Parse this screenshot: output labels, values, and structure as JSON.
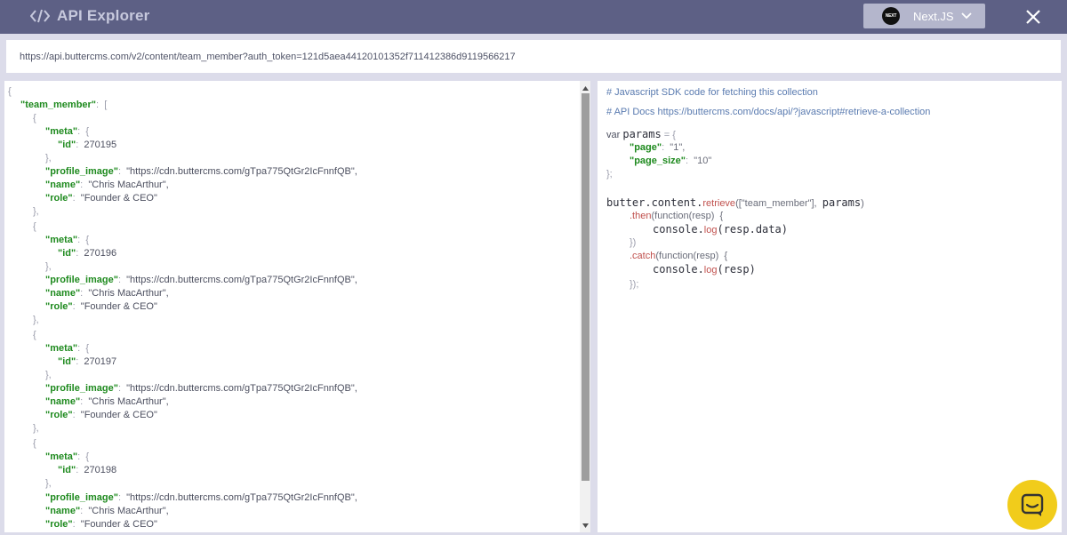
{
  "header": {
    "title": "API Explorer",
    "framework_logo_text": "NEXT",
    "framework_label": "Next.JS"
  },
  "url_bar": {
    "url": "https://api.buttercms.com/v2/content/team_member?auth_token=121d5aea44120101352f711412386d9119566217"
  },
  "json": {
    "open_brace": "{",
    "root_key": "\"team_member\"",
    "colon": ":",
    "open_bracket": "[",
    "items": [
      {
        "open": "{",
        "meta_key": "\"meta\"",
        "meta_open": "{",
        "id_key": "\"id\"",
        "id_value": "270195",
        "meta_close": "},",
        "image_key": "\"profile_image\"",
        "image_value": "\"https://cdn.buttercms.com/gTpa775QtGr2IcFnnfQB\",",
        "name_key": "\"name\"",
        "name_value": "\"Chris MacArthur\",",
        "role_key": "\"role\"",
        "role_value": "\"Founder & CEO\"",
        "close": "},"
      },
      {
        "open": "{",
        "meta_key": "\"meta\"",
        "meta_open": "{",
        "id_key": "\"id\"",
        "id_value": "270196",
        "meta_close": "},",
        "image_key": "\"profile_image\"",
        "image_value": "\"https://cdn.buttercms.com/gTpa775QtGr2IcFnnfQB\",",
        "name_key": "\"name\"",
        "name_value": "\"Chris MacArthur\",",
        "role_key": "\"role\"",
        "role_value": "\"Founder & CEO\"",
        "close": "},"
      },
      {
        "open": "{",
        "meta_key": "\"meta\"",
        "meta_open": "{",
        "id_key": "\"id\"",
        "id_value": "270197",
        "meta_close": "},",
        "image_key": "\"profile_image\"",
        "image_value": "\"https://cdn.buttercms.com/gTpa775QtGr2IcFnnfQB\",",
        "name_key": "\"name\"",
        "name_value": "\"Chris MacArthur\",",
        "role_key": "\"role\"",
        "role_value": "\"Founder & CEO\"",
        "close": "},"
      },
      {
        "open": "{",
        "meta_key": "\"meta\"",
        "meta_open": "{",
        "id_key": "\"id\"",
        "id_value": "270198",
        "meta_close": "},",
        "image_key": "\"profile_image\"",
        "image_value": "\"https://cdn.buttercms.com/gTpa775QtGr2IcFnnfQB\",",
        "name_key": "\"name\"",
        "name_value": "\"Chris MacArthur\",",
        "role_key": "\"role\"",
        "role_value": "\"Founder & CEO\"",
        "close": ""
      }
    ]
  },
  "sdk": {
    "comment_1": "# Javascript SDK code for fetching this collection",
    "comment_2": "# API Docs https://buttercms.com/docs/api/?javascript#retrieve-a-collection",
    "var_kw": "var",
    "params_name": "params",
    "eq_brace": "= {",
    "page_key": "\"page\"",
    "page_value": "\"1\",",
    "page_size_key": "\"page_size\"",
    "page_size_value": "\"10\"",
    "params_close": "};",
    "call_obj": "butter.content.",
    "call_fn": "retrieve",
    "call_args": "([\"team_member\"],",
    "call_params": "params",
    "call_close": ")",
    "then_fn": ".then",
    "then_args": "(function(resp)  {",
    "console_1": "console.",
    "log_1": "log",
    "log_args_1": "(resp.data)",
    "then_close": "})",
    "catch_fn": ".catch",
    "catch_args": "(function(resp)  {",
    "console_2": "console.",
    "log_2": "log",
    "log_args_2": "(resp)",
    "catch_close": "});"
  },
  "colors": {
    "header_bg": "#5d6085",
    "key_green": "#1e8a1e",
    "comment_blue": "#5a7bb0",
    "function_red": "#c0504d",
    "chat_yellow": "#f1cc1b"
  },
  "icons": {
    "title": "code-brackets-icon",
    "framework": "nextjs-logo-icon",
    "dropdown": "chevron-down-icon",
    "close": "close-icon",
    "chat": "chat-bubble-icon"
  }
}
